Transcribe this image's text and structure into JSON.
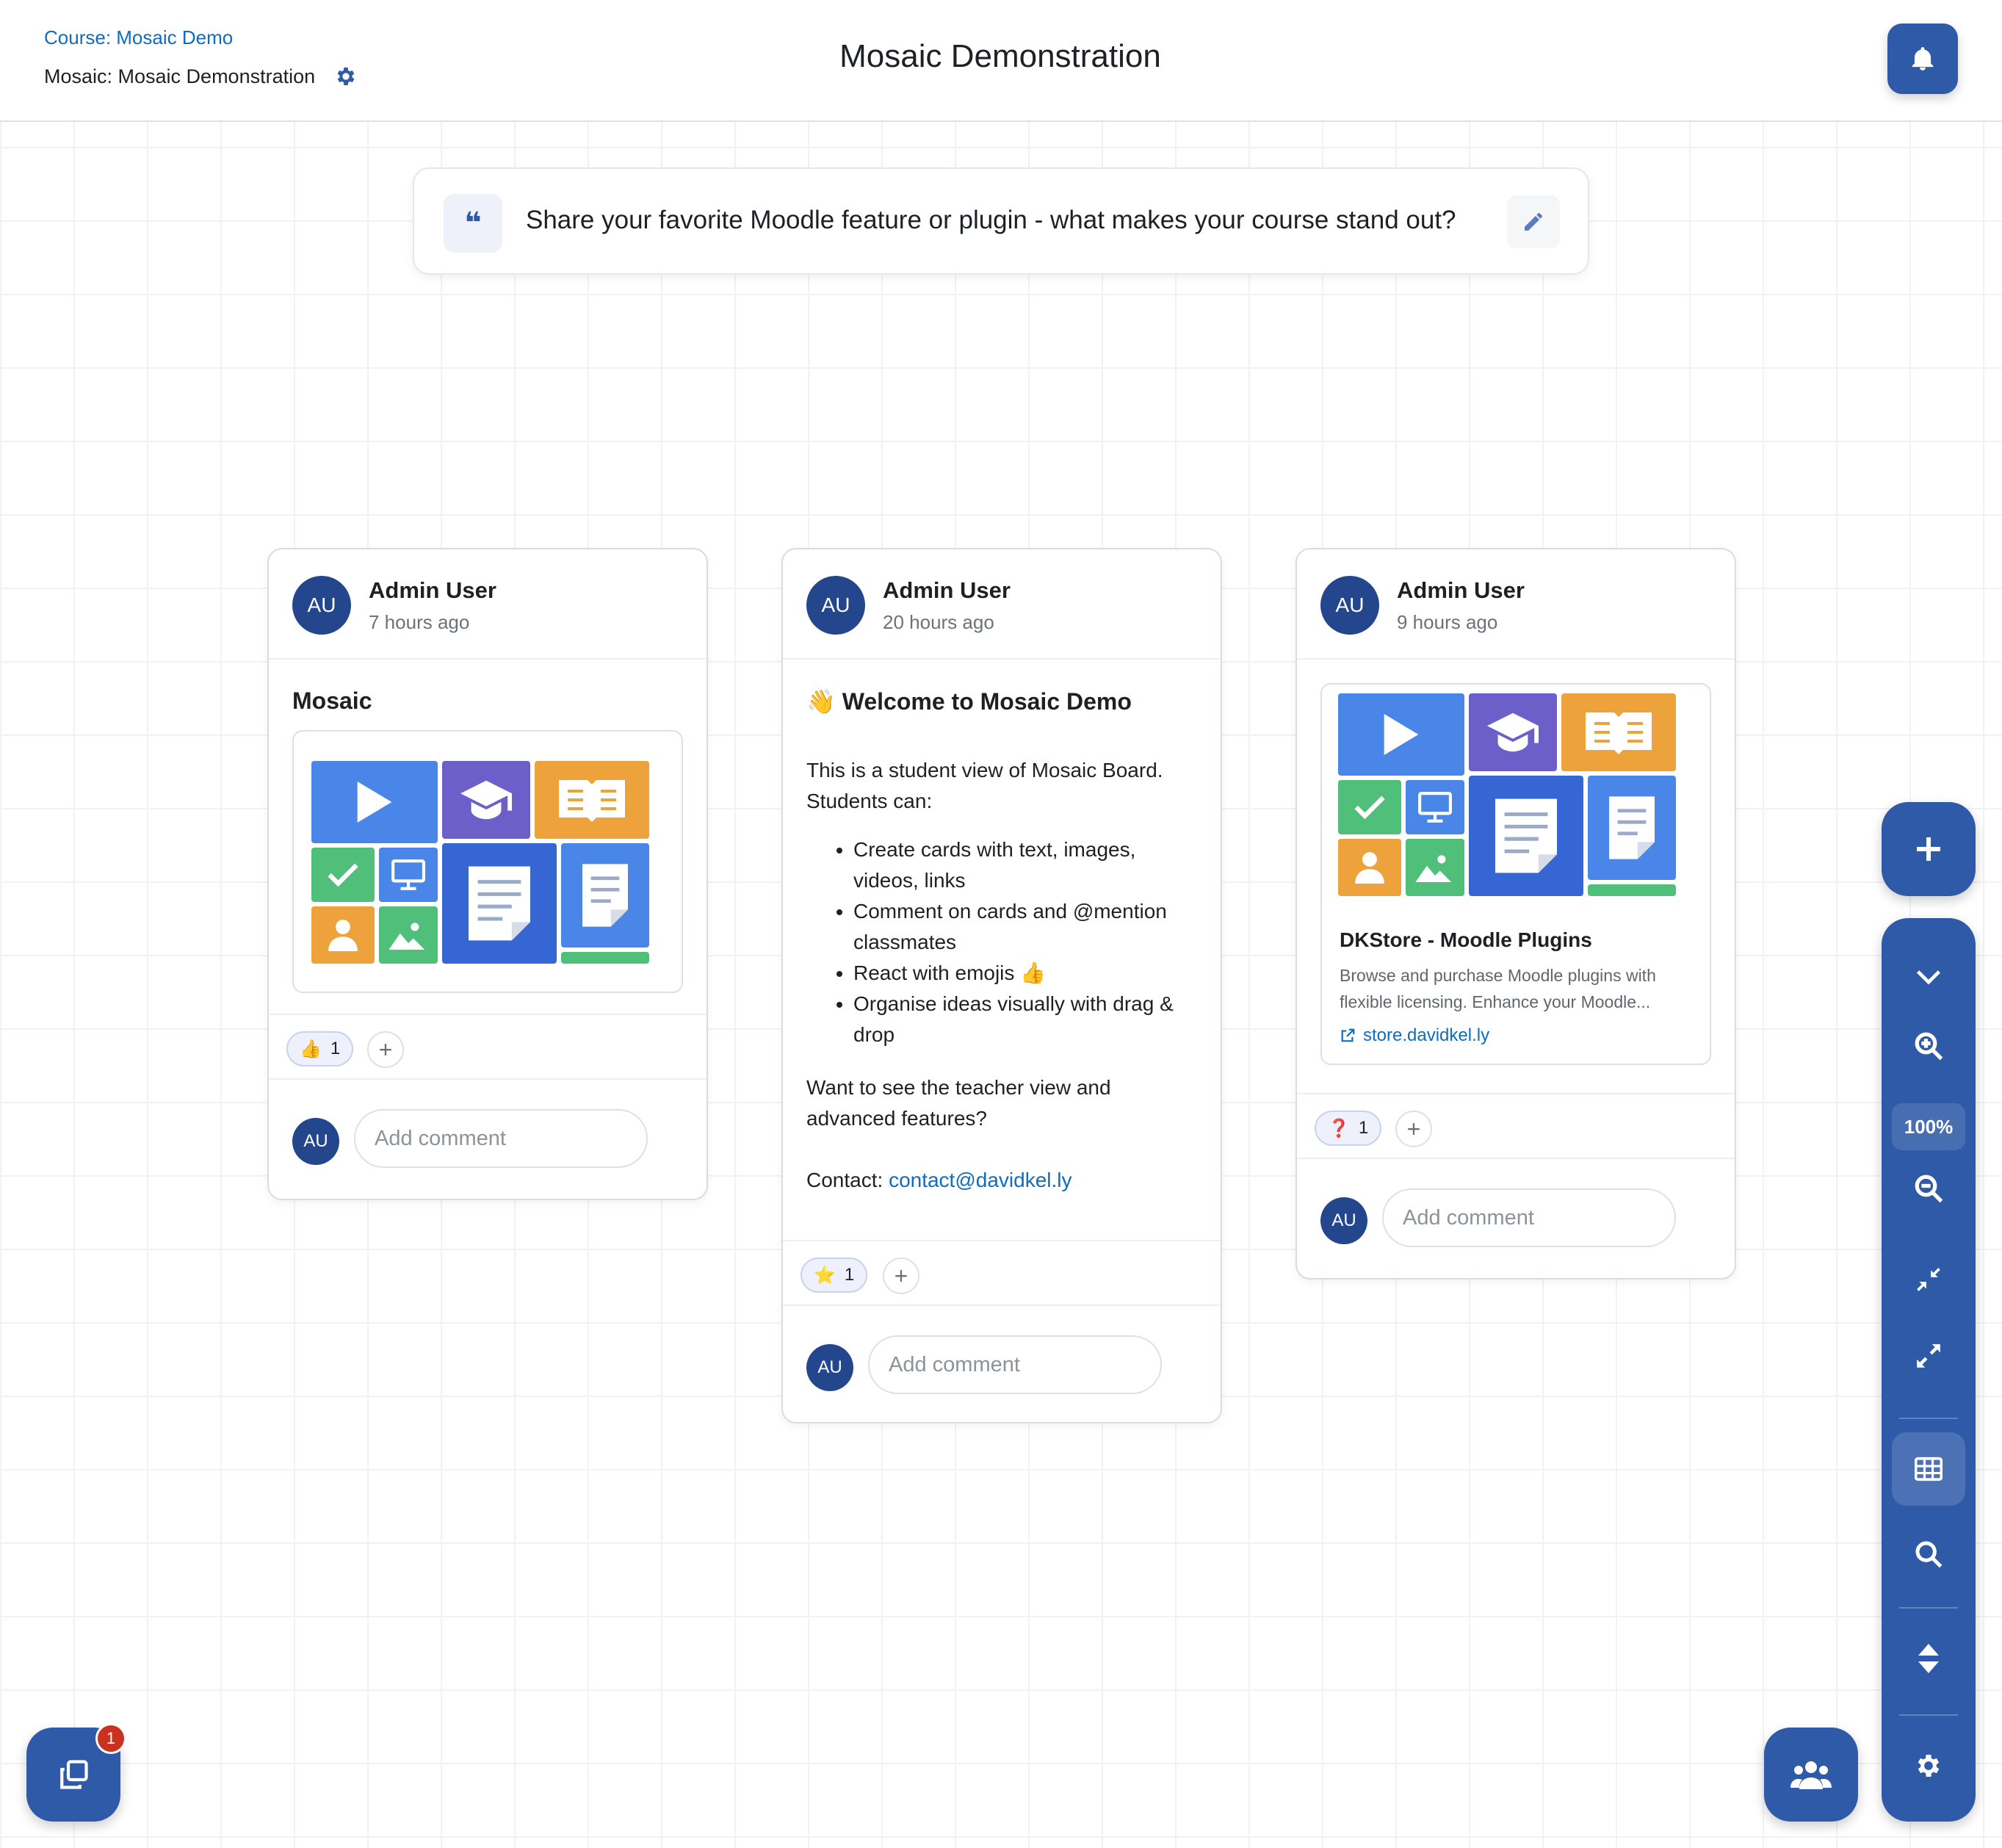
{
  "header": {
    "breadcrumb": "Course: Mosaic Demo",
    "activity": "Mosaic: Mosaic Demonstration",
    "title": "Mosaic Demonstration"
  },
  "prompt": {
    "quote_glyph": "❝",
    "text": "Share your favorite Moodle feature or plugin - what makes your course stand out?"
  },
  "cards": [
    {
      "initials": "AU",
      "author": "Admin User",
      "time": "7 hours ago",
      "title": "Mosaic",
      "reaction_emoji": "👍",
      "reaction_count": "1",
      "add_reaction": "+",
      "comment_initials": "AU",
      "comment_placeholder": "Add comment"
    },
    {
      "initials": "AU",
      "author": "Admin User",
      "time": "20 hours ago",
      "title": "👋 Welcome to Mosaic Demo",
      "intro": "This is a student view of Mosaic Board. Students can:",
      "bullets": [
        "Create cards with text, images, videos, links",
        "Comment on cards and @mention classmates",
        "React with emojis 👍",
        "Organise ideas visually with drag & drop"
      ],
      "outro": "Want to see the teacher view and advanced features?",
      "contact_label": "Contact: ",
      "contact_email": "contact@davidkel.ly",
      "reaction_emoji": "⭐",
      "reaction_count": "1",
      "add_reaction": "+",
      "comment_initials": "AU",
      "comment_placeholder": "Add comment"
    },
    {
      "initials": "AU",
      "author": "Admin User",
      "time": "9 hours ago",
      "link_title": "DKStore - Moodle Plugins",
      "link_desc": "Browse and purchase Moodle plugins with flexible licensing. Enhance your Moodle...",
      "link_url": "store.davidkel.ly",
      "reaction_emoji": "❓",
      "reaction_count": "1",
      "add_reaction": "+",
      "comment_initials": "AU",
      "comment_placeholder": "Add comment"
    }
  ],
  "toolbar": {
    "zoom": "100%"
  },
  "notifications_badge": "1",
  "colors": {
    "primary": "#2f5aa8",
    "avatar": "#24468d",
    "link": "#0f6cbf",
    "tile_blue": "#4a86e8",
    "tile_purple": "#6d5fc9",
    "tile_orange": "#eea23b",
    "tile_green": "#4fbf7a",
    "tile_navy": "#3566d4"
  },
  "icons": [
    "settings-icon",
    "bell-icon",
    "quote-icon",
    "pencil-icon",
    "plus-icon",
    "chevron-down-icon",
    "zoom-in-icon",
    "zoom-out-icon",
    "compress-icon",
    "expand-icon",
    "grid-icon",
    "search-icon",
    "sort-icon",
    "gear-icon",
    "users-icon",
    "copy-icon",
    "external-link-icon"
  ]
}
